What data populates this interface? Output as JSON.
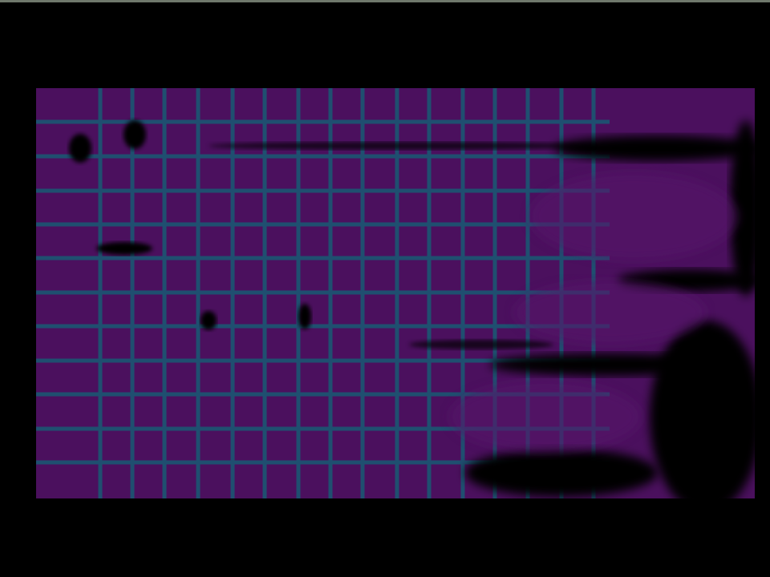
{
  "colors": {
    "background": "#000000",
    "tile": "#4b105e",
    "tile_dark": "#3a0c4a",
    "grid_line": "#1f4f70",
    "top_strip": "#6f786c"
  }
}
